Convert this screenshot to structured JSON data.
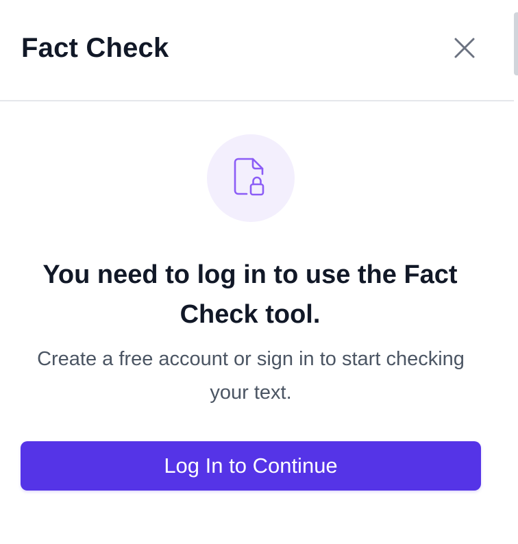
{
  "header": {
    "title": "Fact Check",
    "close_icon": "close-icon"
  },
  "prompt": {
    "icon": "document-lock-icon",
    "heading": "You need to log in to use the Fact Check tool.",
    "subtext": "Create a free account or sign in to start checking your text.",
    "button_label": "Log In to Continue"
  },
  "colors": {
    "accent": "#5534e7",
    "icon_stroke": "#8b5cf6",
    "icon_bg": "#f3effd",
    "heading_text": "#111827",
    "body_text": "#4b5563",
    "close_icon": "#6b7280"
  }
}
